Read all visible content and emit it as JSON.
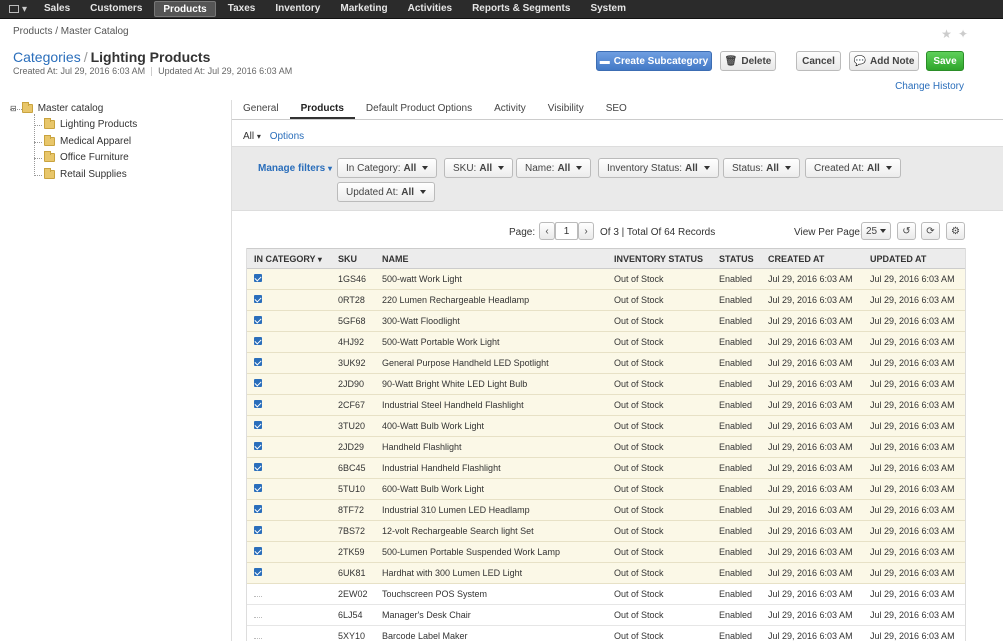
{
  "topnav": {
    "items": [
      "Sales",
      "Customers",
      "Products",
      "Taxes",
      "Inventory",
      "Marketing",
      "Activities",
      "Reports & Segments",
      "System"
    ],
    "active": "Products"
  },
  "breadcrumb": "Products / Master Catalog",
  "title": {
    "parent": "Categories",
    "separator": "/",
    "current": "Lighting Products"
  },
  "meta": {
    "created": "Created At: Jul 29, 2016 6:03 AM",
    "updated": "Updated At: Jul 29, 2016 6:03 AM"
  },
  "actions": {
    "create_subcategory": "Create Subcategory",
    "delete": "Delete",
    "cancel": "Cancel",
    "add_note": "Add Note",
    "save": "Save",
    "change_history": "Change History"
  },
  "tree": {
    "root": "Master catalog",
    "children": [
      "Lighting Products",
      "Medical Apparel",
      "Office Furniture",
      "Retail Supplies"
    ]
  },
  "tabs": [
    "General",
    "Products",
    "Default Product Options",
    "Activity",
    "Visibility",
    "SEO"
  ],
  "active_tab": "Products",
  "subbar": {
    "all": "All",
    "options": "Options"
  },
  "filters": {
    "manage": "Manage filters",
    "items": [
      {
        "label": "In Category:",
        "value": "All"
      },
      {
        "label": "SKU:",
        "value": "All"
      },
      {
        "label": "Name:",
        "value": "All"
      },
      {
        "label": "Inventory Status:",
        "value": "All"
      },
      {
        "label": "Status:",
        "value": "All"
      },
      {
        "label": "Created At:",
        "value": "All"
      },
      {
        "label": "Updated At:",
        "value": "All"
      }
    ]
  },
  "pager": {
    "page_label": "Page:",
    "page": "1",
    "of": "Of 3 | Total Of 64 Records",
    "per_page_label": "View Per Page:",
    "per_page": "25"
  },
  "columns": [
    "IN CATEGORY",
    "SKU",
    "NAME",
    "INVENTORY STATUS",
    "STATUS",
    "CREATED AT",
    "UPDATED AT"
  ],
  "rows": [
    {
      "in": true,
      "sku": "1GS46",
      "name": "500-watt Work Light",
      "inv": "Out of Stock",
      "status": "Enabled",
      "created": "Jul 29, 2016 6:03 AM",
      "updated": "Jul 29, 2016 6:03 AM"
    },
    {
      "in": true,
      "sku": "0RT28",
      "name": "220 Lumen Rechargeable Headlamp",
      "inv": "Out of Stock",
      "status": "Enabled",
      "created": "Jul 29, 2016 6:03 AM",
      "updated": "Jul 29, 2016 6:03 AM"
    },
    {
      "in": true,
      "sku": "5GF68",
      "name": "300-Watt Floodlight",
      "inv": "Out of Stock",
      "status": "Enabled",
      "created": "Jul 29, 2016 6:03 AM",
      "updated": "Jul 29, 2016 6:03 AM"
    },
    {
      "in": true,
      "sku": "4HJ92",
      "name": "500-Watt Portable Work Light",
      "inv": "Out of Stock",
      "status": "Enabled",
      "created": "Jul 29, 2016 6:03 AM",
      "updated": "Jul 29, 2016 6:03 AM"
    },
    {
      "in": true,
      "sku": "3UK92",
      "name": "General Purpose Handheld LED Spotlight",
      "inv": "Out of Stock",
      "status": "Enabled",
      "created": "Jul 29, 2016 6:03 AM",
      "updated": "Jul 29, 2016 6:03 AM"
    },
    {
      "in": true,
      "sku": "2JD90",
      "name": "90-Watt Bright White LED Light Bulb",
      "inv": "Out of Stock",
      "status": "Enabled",
      "created": "Jul 29, 2016 6:03 AM",
      "updated": "Jul 29, 2016 6:03 AM"
    },
    {
      "in": true,
      "sku": "2CF67",
      "name": "Industrial Steel Handheld Flashlight",
      "inv": "Out of Stock",
      "status": "Enabled",
      "created": "Jul 29, 2016 6:03 AM",
      "updated": "Jul 29, 2016 6:03 AM"
    },
    {
      "in": true,
      "sku": "3TU20",
      "name": "400-Watt Bulb Work Light",
      "inv": "Out of Stock",
      "status": "Enabled",
      "created": "Jul 29, 2016 6:03 AM",
      "updated": "Jul 29, 2016 6:03 AM"
    },
    {
      "in": true,
      "sku": "2JD29",
      "name": "Handheld Flashlight",
      "inv": "Out of Stock",
      "status": "Enabled",
      "created": "Jul 29, 2016 6:03 AM",
      "updated": "Jul 29, 2016 6:03 AM"
    },
    {
      "in": true,
      "sku": "6BC45",
      "name": "Industrial Handheld Flashlight",
      "inv": "Out of Stock",
      "status": "Enabled",
      "created": "Jul 29, 2016 6:03 AM",
      "updated": "Jul 29, 2016 6:03 AM"
    },
    {
      "in": true,
      "sku": "5TU10",
      "name": "600-Watt Bulb Work Light",
      "inv": "Out of Stock",
      "status": "Enabled",
      "created": "Jul 29, 2016 6:03 AM",
      "updated": "Jul 29, 2016 6:03 AM"
    },
    {
      "in": true,
      "sku": "8TF72",
      "name": "Industrial 310 Lumen LED Headlamp",
      "inv": "Out of Stock",
      "status": "Enabled",
      "created": "Jul 29, 2016 6:03 AM",
      "updated": "Jul 29, 2016 6:03 AM"
    },
    {
      "in": true,
      "sku": "7BS72",
      "name": "12-volt Rechargeable Search light Set",
      "inv": "Out of Stock",
      "status": "Enabled",
      "created": "Jul 29, 2016 6:03 AM",
      "updated": "Jul 29, 2016 6:03 AM"
    },
    {
      "in": true,
      "sku": "2TK59",
      "name": "500-Lumen Portable Suspended Work Lamp",
      "inv": "Out of Stock",
      "status": "Enabled",
      "created": "Jul 29, 2016 6:03 AM",
      "updated": "Jul 29, 2016 6:03 AM"
    },
    {
      "in": true,
      "sku": "6UK81",
      "name": "Hardhat with 300 Lumen LED Light",
      "inv": "Out of Stock",
      "status": "Enabled",
      "created": "Jul 29, 2016 6:03 AM",
      "updated": "Jul 29, 2016 6:03 AM"
    },
    {
      "in": false,
      "sku": "2EW02",
      "name": "Touchscreen POS System",
      "inv": "Out of Stock",
      "status": "Enabled",
      "created": "Jul 29, 2016 6:03 AM",
      "updated": "Jul 29, 2016 6:03 AM"
    },
    {
      "in": false,
      "sku": "6LJ54",
      "name": "Manager's Desk Chair",
      "inv": "Out of Stock",
      "status": "Enabled",
      "created": "Jul 29, 2016 6:03 AM",
      "updated": "Jul 29, 2016 6:03 AM"
    },
    {
      "in": false,
      "sku": "5XY10",
      "name": "Barcode Label Maker",
      "inv": "Out of Stock",
      "status": "Enabled",
      "created": "Jul 29, 2016 6:03 AM",
      "updated": "Jul 29, 2016 6:03 AM"
    }
  ]
}
